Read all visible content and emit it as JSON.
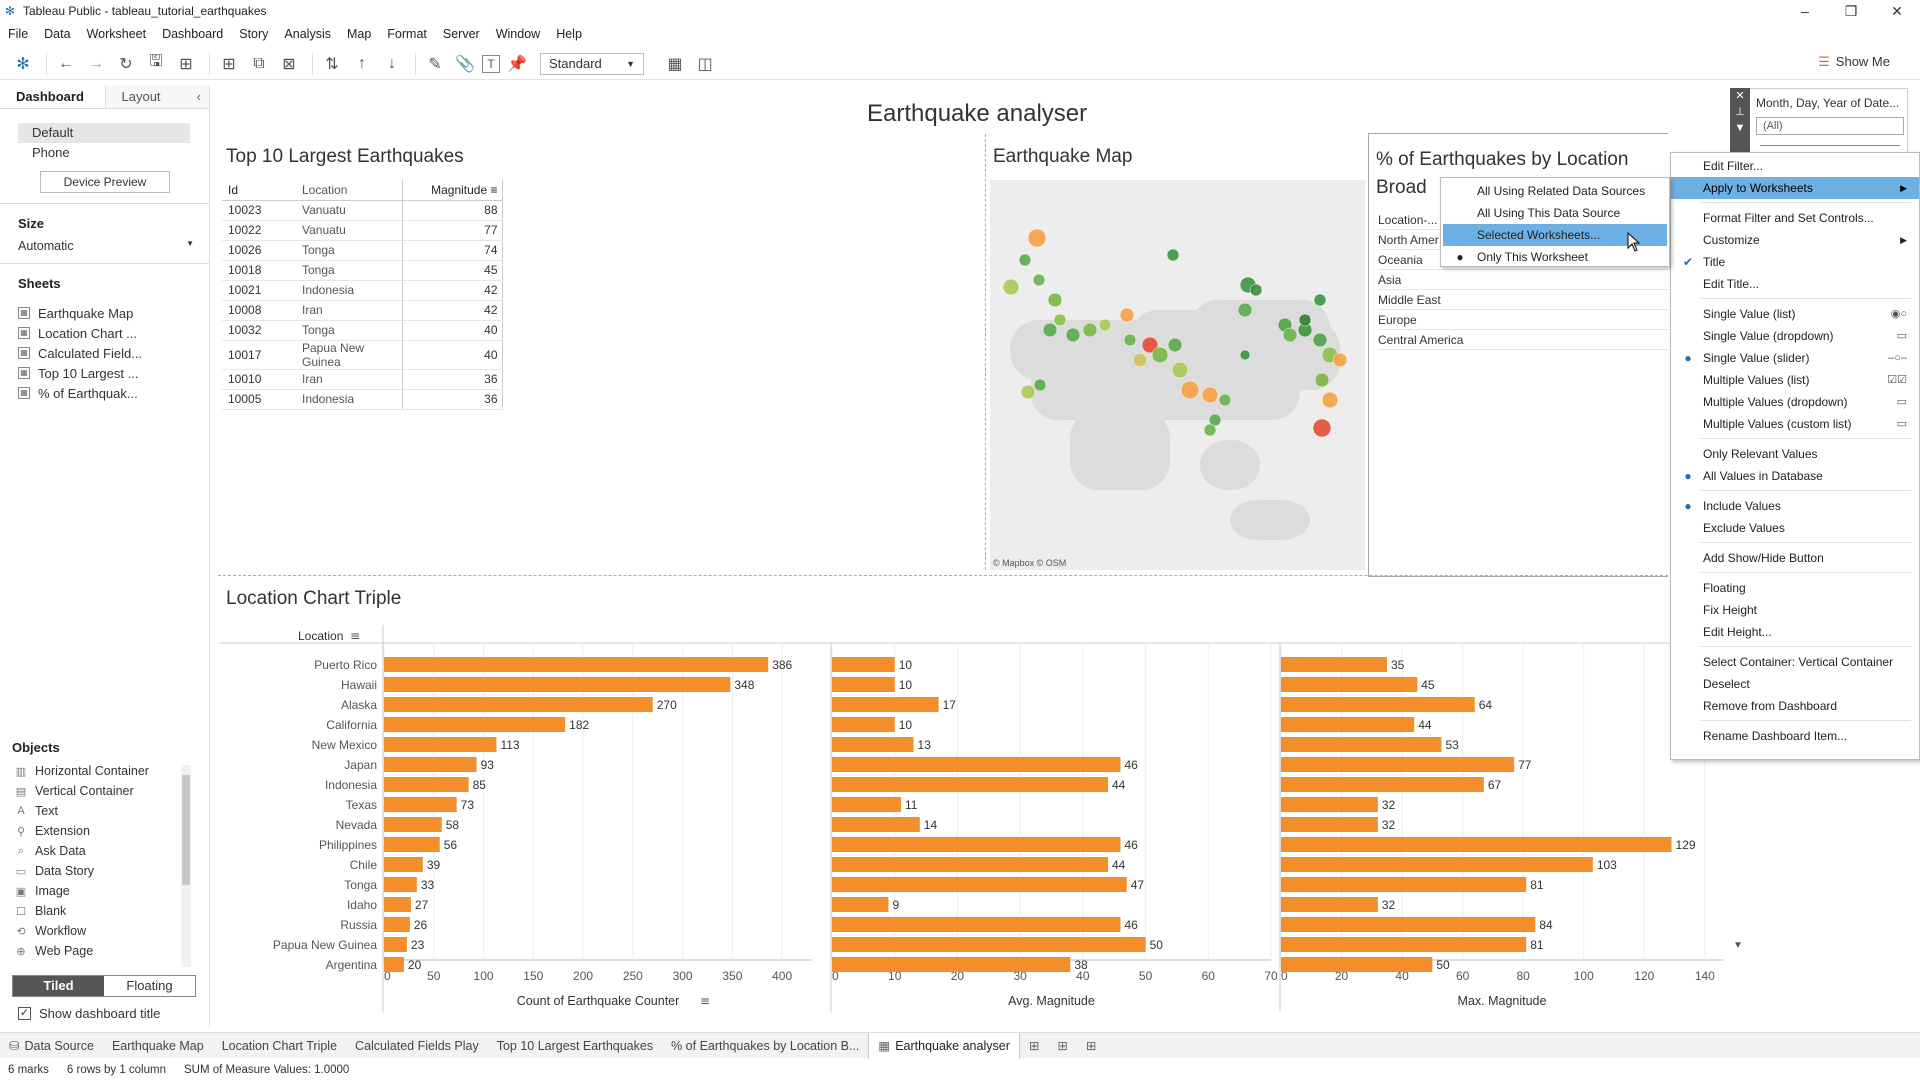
{
  "window": {
    "title": "Tableau Public - tableau_tutorial_earthquakes"
  },
  "menu": [
    "File",
    "Data",
    "Worksheet",
    "Dashboard",
    "Story",
    "Analysis",
    "Map",
    "Format",
    "Server",
    "Window",
    "Help"
  ],
  "toolbar": {
    "fit": "Standard",
    "show_me": "Show Me"
  },
  "left_pane": {
    "tabs": {
      "dashboard": "Dashboard",
      "layout": "Layout"
    },
    "devices": [
      "Default",
      "Phone"
    ],
    "device_preview": "Device Preview",
    "size_label": "Size",
    "size_value": "Automatic",
    "sheets_label": "Sheets",
    "sheets": [
      "Earthquake Map",
      "Location Chart ...",
      "Calculated Field...",
      "Top 10 Largest ...",
      "% of Earthquak..."
    ],
    "objects_label": "Objects",
    "objects": [
      {
        "label": "Horizontal Container",
        "icon": "horizontal-container-icon"
      },
      {
        "label": "Vertical Container",
        "icon": "vertical-container-icon"
      },
      {
        "label": "Text",
        "icon": "text-icon"
      },
      {
        "label": "Extension",
        "icon": "extension-icon"
      },
      {
        "label": "Ask Data",
        "icon": "ask-data-icon"
      },
      {
        "label": "Data Story",
        "icon": "data-story-icon"
      },
      {
        "label": "Image",
        "icon": "image-icon"
      },
      {
        "label": "Blank",
        "icon": "blank-icon"
      },
      {
        "label": "Workflow",
        "icon": "workflow-icon"
      },
      {
        "label": "Web Page",
        "icon": "web-page-icon"
      }
    ],
    "tiled": "Tiled",
    "floating": "Floating",
    "show_title": "Show dashboard title"
  },
  "dashboard": {
    "title": "Earthquake analyser",
    "top10": {
      "title": "Top 10 Largest Earthquakes",
      "headers": [
        "Id",
        "Location",
        "Magnitude"
      ],
      "rows": [
        [
          "10023",
          "Vanuatu",
          "88"
        ],
        [
          "10022",
          "Vanuatu",
          "77"
        ],
        [
          "10026",
          "Tonga",
          "74"
        ],
        [
          "10018",
          "Tonga",
          "45"
        ],
        [
          "10021",
          "Indonesia",
          "42"
        ],
        [
          "10008",
          "Iran",
          "42"
        ],
        [
          "10032",
          "Tonga",
          "40"
        ],
        [
          "10017",
          "Papua New Guinea",
          "40"
        ],
        [
          "10010",
          "Iran",
          "36"
        ],
        [
          "10005",
          "Indonesia",
          "36"
        ]
      ]
    },
    "map": {
      "title": "Earthquake Map",
      "attribution": "© Mapbox © OSM"
    },
    "pct": {
      "title_line1": "% of Earthquakes by Location",
      "title_line2": "Broad",
      "rows": [
        "Location-...",
        "North Amer",
        "Oceania",
        "Asia",
        "Middle East",
        "Europe",
        "Central America"
      ]
    },
    "location_chart_title": "Location Chart Triple"
  },
  "filter": {
    "title": "Month, Day, Year of Date...",
    "value": "(All)"
  },
  "context_menu": {
    "items": [
      {
        "label": "Edit Filter...",
        "check": "",
        "arrow": false,
        "icon": ""
      },
      {
        "label": "Apply to Worksheets",
        "check": "",
        "arrow": true,
        "icon": "",
        "highlight": true
      },
      {
        "sep": true
      },
      {
        "label": "Format Filter and Set Controls...",
        "check": "",
        "arrow": false,
        "icon": ""
      },
      {
        "label": "Customize",
        "check": "",
        "arrow": true,
        "icon": ""
      },
      {
        "label": "Title",
        "check": "✔",
        "arrow": false,
        "icon": ""
      },
      {
        "label": "Edit Title...",
        "check": "",
        "arrow": false,
        "icon": ""
      },
      {
        "sep": true
      },
      {
        "label": "Single Value (list)",
        "check": "",
        "arrow": false,
        "icon": "◉○"
      },
      {
        "label": "Single Value (dropdown)",
        "check": "",
        "arrow": false,
        "icon": "▭"
      },
      {
        "label": "Single Value (slider)",
        "check": "●",
        "arrow": false,
        "icon": "–○–"
      },
      {
        "label": "Multiple Values (list)",
        "check": "",
        "arrow": false,
        "icon": "☑☑"
      },
      {
        "label": "Multiple Values (dropdown)",
        "check": "",
        "arrow": false,
        "icon": "▭"
      },
      {
        "label": "Multiple Values (custom list)",
        "check": "",
        "arrow": false,
        "icon": "▭"
      },
      {
        "sep": true
      },
      {
        "label": "Only Relevant Values",
        "check": "",
        "arrow": false,
        "icon": ""
      },
      {
        "label": "All Values in Database",
        "check": "●",
        "arrow": false,
        "icon": ""
      },
      {
        "sep": true
      },
      {
        "label": "Include Values",
        "check": "●",
        "arrow": false,
        "icon": ""
      },
      {
        "label": "Exclude Values",
        "check": "",
        "arrow": false,
        "icon": ""
      },
      {
        "sep": true
      },
      {
        "label": "Add Show/Hide Button",
        "check": "",
        "arrow": false,
        "icon": ""
      },
      {
        "sep": true
      },
      {
        "label": "Floating",
        "check": "",
        "arrow": false,
        "icon": ""
      },
      {
        "label": "Fix Height",
        "check": "",
        "arrow": false,
        "icon": ""
      },
      {
        "label": "Edit Height...",
        "check": "",
        "arrow": false,
        "icon": ""
      },
      {
        "sep": true
      },
      {
        "label": "Select Container: Vertical Container",
        "check": "",
        "arrow": false,
        "icon": ""
      },
      {
        "label": "Deselect",
        "check": "",
        "arrow": false,
        "icon": ""
      },
      {
        "label": "Remove from Dashboard",
        "check": "",
        "arrow": false,
        "icon": ""
      },
      {
        "sep": true
      },
      {
        "label": "Rename Dashboard Item...",
        "check": "",
        "arrow": false,
        "icon": ""
      }
    ]
  },
  "submenu": {
    "items": [
      {
        "label": "All Using Related Data Sources",
        "check": ""
      },
      {
        "label": "All Using This Data Source",
        "check": ""
      },
      {
        "label": "Selected Worksheets...",
        "check": "",
        "highlight": true
      },
      {
        "label": "Only This Worksheet",
        "check": "●"
      }
    ]
  },
  "tabs": [
    "Data Source",
    "Earthquake Map",
    "Location Chart Triple",
    "Calculated Fields Play",
    "Top 10 Largest Earthquakes",
    "% of Earthquakes by Location B...",
    "Earthquake analyser"
  ],
  "active_tab": "Earthquake analyser",
  "status": {
    "marks": "6 marks",
    "rows": "6 rows by 1 column",
    "sum": "SUM of Measure Values: 1.0000"
  },
  "colors": {
    "bar": "#f28e2b",
    "highlight": "#6db1e4",
    "accent_orange": "#e36f2b"
  },
  "chart_data": [
    {
      "type": "bar",
      "orientation": "horizontal",
      "row_header": "Location",
      "categories": [
        "Puerto Rico",
        "Hawaii",
        "Alaska",
        "California",
        "New Mexico",
        "Japan",
        "Indonesia",
        "Texas",
        "Nevada",
        "Philippines",
        "Chile",
        "Tonga",
        "Idaho",
        "Russia",
        "Papua New Guinea",
        "Argentina"
      ],
      "panes": [
        {
          "xlabel": "Count of Earthquake Counter",
          "xlim": [
            0,
            430
          ],
          "ticks": [
            0,
            50,
            100,
            150,
            200,
            250,
            300,
            350,
            400
          ],
          "values": [
            386,
            348,
            270,
            182,
            113,
            93,
            85,
            73,
            58,
            56,
            39,
            33,
            27,
            26,
            23,
            20
          ]
        },
        {
          "xlabel": "Avg. Magnitude",
          "xlim": [
            0,
            70
          ],
          "ticks": [
            0,
            10,
            20,
            30,
            40,
            50,
            60,
            70
          ],
          "values": [
            10,
            10,
            17,
            10,
            13,
            46,
            44,
            11,
            14,
            46,
            44,
            47,
            9,
            46,
            50,
            38
          ]
        },
        {
          "xlabel": "Max. Magnitude",
          "xlim": [
            0,
            146
          ],
          "ticks": [
            0,
            20,
            40,
            60,
            80,
            100,
            120,
            140
          ],
          "values": [
            35,
            45,
            64,
            44,
            53,
            77,
            67,
            32,
            32,
            129,
            103,
            81,
            32,
            84,
            81,
            50
          ]
        }
      ]
    },
    {
      "type": "scatter",
      "note_type": "symbol-map",
      "title": "Earthquake Map",
      "points": [
        [
          1037,
          238,
          "#f5a142",
          9
        ],
        [
          1011,
          287,
          "#a8c957",
          8
        ],
        [
          1025,
          260,
          "#5aa84f",
          6
        ],
        [
          1039,
          280,
          "#6bb24a",
          6
        ],
        [
          1055,
          300,
          "#7ab845",
          7
        ],
        [
          1060,
          320,
          "#8ec04a",
          6
        ],
        [
          1050,
          330,
          "#5aa84f",
          7
        ],
        [
          1073,
          335,
          "#5aa84f",
          7
        ],
        [
          1090,
          330,
          "#7ab845",
          7
        ],
        [
          1105,
          325,
          "#a8c957",
          6
        ],
        [
          1127,
          315,
          "#f5a142",
          7
        ],
        [
          1150,
          345,
          "#e44b35",
          8
        ],
        [
          1140,
          360,
          "#d2c15c",
          7
        ],
        [
          1160,
          355,
          "#7ab845",
          8
        ],
        [
          1175,
          345,
          "#5aa84f",
          7
        ],
        [
          1180,
          370,
          "#a8c957",
          8
        ],
        [
          1190,
          390,
          "#f5a142",
          9
        ],
        [
          1210,
          395,
          "#f5a142",
          8
        ],
        [
          1225,
          400,
          "#6bb24a",
          6
        ],
        [
          1215,
          420,
          "#5aa84f",
          6
        ],
        [
          1245,
          310,
          "#5aa84f",
          7
        ],
        [
          1248,
          285,
          "#37963f",
          8
        ],
        [
          1256,
          290,
          "#3e8e41",
          6
        ],
        [
          1285,
          325,
          "#4fa34a",
          7
        ],
        [
          1290,
          335,
          "#6bb24a",
          7
        ],
        [
          1305,
          330,
          "#37963f",
          7
        ],
        [
          1320,
          340,
          "#4fa34a",
          7
        ],
        [
          1330,
          355,
          "#8ec04a",
          8
        ],
        [
          1340,
          360,
          "#f5a142",
          7
        ],
        [
          1322,
          380,
          "#7ab845",
          7
        ],
        [
          1330,
          400,
          "#f5a142",
          8
        ],
        [
          1322,
          428,
          "#e44b35",
          9
        ],
        [
          1173,
          255,
          "#37963f",
          6
        ],
        [
          1245,
          355,
          "#37963f",
          5
        ],
        [
          1028,
          392,
          "#a8c957",
          7
        ],
        [
          1040,
          385,
          "#5aa84f",
          6
        ],
        [
          1320,
          300,
          "#37963f",
          6
        ],
        [
          1305,
          320,
          "#2e7d32",
          6
        ],
        [
          1210,
          430,
          "#6bb24a",
          6
        ],
        [
          1130,
          340,
          "#6bb24a",
          6
        ]
      ]
    }
  ]
}
